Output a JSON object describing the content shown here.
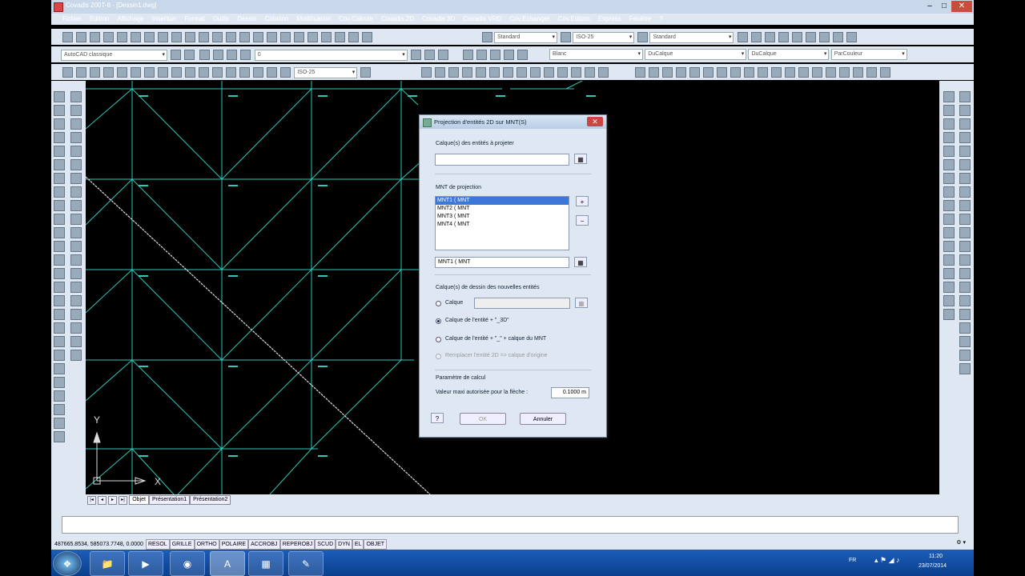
{
  "window": {
    "title": "Covadis 2007-8 - [Dessin1.dwg]"
  },
  "menu": [
    "Fichier",
    "Edition",
    "Affichage",
    "Insertion",
    "Format",
    "Outils",
    "Dessin",
    "Cotation",
    "Modification",
    "Cov.Calcule",
    "Covadis 2D",
    "Covadis 3D",
    "Covadis VRD",
    "Cov.Echanger",
    "Cov.Edition",
    "Express",
    "Fenêtre",
    "?"
  ],
  "toolbar": {
    "text_style": "Standard",
    "dim_style": "ISO-25",
    "table_style": "Standard",
    "workspace": "AutoCAD classique",
    "layer": "0",
    "color": "Blanc",
    "linetype": "DuCalque",
    "lineweight": "DuCalque",
    "plotstyle": "ParCouleur",
    "dim_style2": "ISO-25"
  },
  "tabs": [
    "Objet",
    "Présentation1",
    "Présentation2"
  ],
  "status": {
    "coords": "487665.8534, 585073.7748, 0.0000",
    "buttons": [
      "RESOL",
      "GRILLE",
      "ORTHO",
      "POLAIRE",
      "ACCROBJ",
      "REPEROBJ",
      "SCUD",
      "DYN",
      "EL",
      "OBJET"
    ]
  },
  "ucs": {
    "y": "Y",
    "x": "X"
  },
  "taskbar": {
    "lang": "FR",
    "time": "11:20",
    "date": "23/07/2014"
  },
  "dialog": {
    "title": "Projection d'entités 2D sur MNT(S)",
    "layers_label": "Calque(s) des entités à projeter",
    "layers_value": "",
    "mnt_label": "MNT de projection",
    "mnt_items": [
      "MNT1 ( MNT",
      "MNT2 ( MNT",
      "MNT3 ( MNT",
      "MNT4 ( MNT"
    ],
    "mnt_selected": "MNT1 ( MNT",
    "draw_layers_label": "Calque(s) de dessin des nouvelles entités",
    "opt_calque": "Calque",
    "opt_calque_value": "",
    "opt_3d": "Calque de l'entité + \"_3D\"",
    "opt_mnt": "Calque de l'entité + \"_\" + calque du MNT",
    "opt_replace": "Remplacer l'entité 2D => calque d'origine",
    "calc_label": "Paramètre de calcul",
    "fleche_label": "Valeur maxi autorisée pour la flèche :",
    "fleche_value": "0.1000 m",
    "ok": "OK",
    "cancel": "Annuler"
  }
}
